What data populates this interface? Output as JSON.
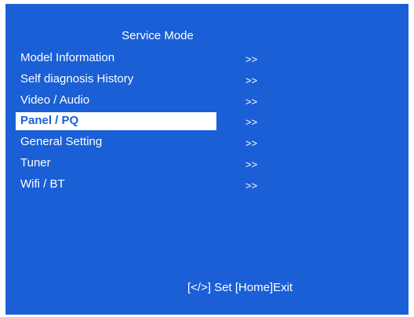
{
  "screen": {
    "title": "Service Mode",
    "footer": "[</>] Set [Home]Exit",
    "background_color": "#1a5fd6",
    "highlight_color": "#ffffff"
  },
  "menu": {
    "selected_index": 3,
    "items": [
      {
        "label": "Model Information",
        "arrow": ">>"
      },
      {
        "label": "Self diagnosis History",
        "arrow": ">>"
      },
      {
        "label": "Video / Audio",
        "arrow": ">>"
      },
      {
        "label": "Panel / PQ",
        "arrow": ">>"
      },
      {
        "label": "General Setting",
        "arrow": ">>"
      },
      {
        "label": "Tuner",
        "arrow": ">>"
      },
      {
        "label": "Wifi / BT",
        "arrow": ">>"
      }
    ]
  }
}
